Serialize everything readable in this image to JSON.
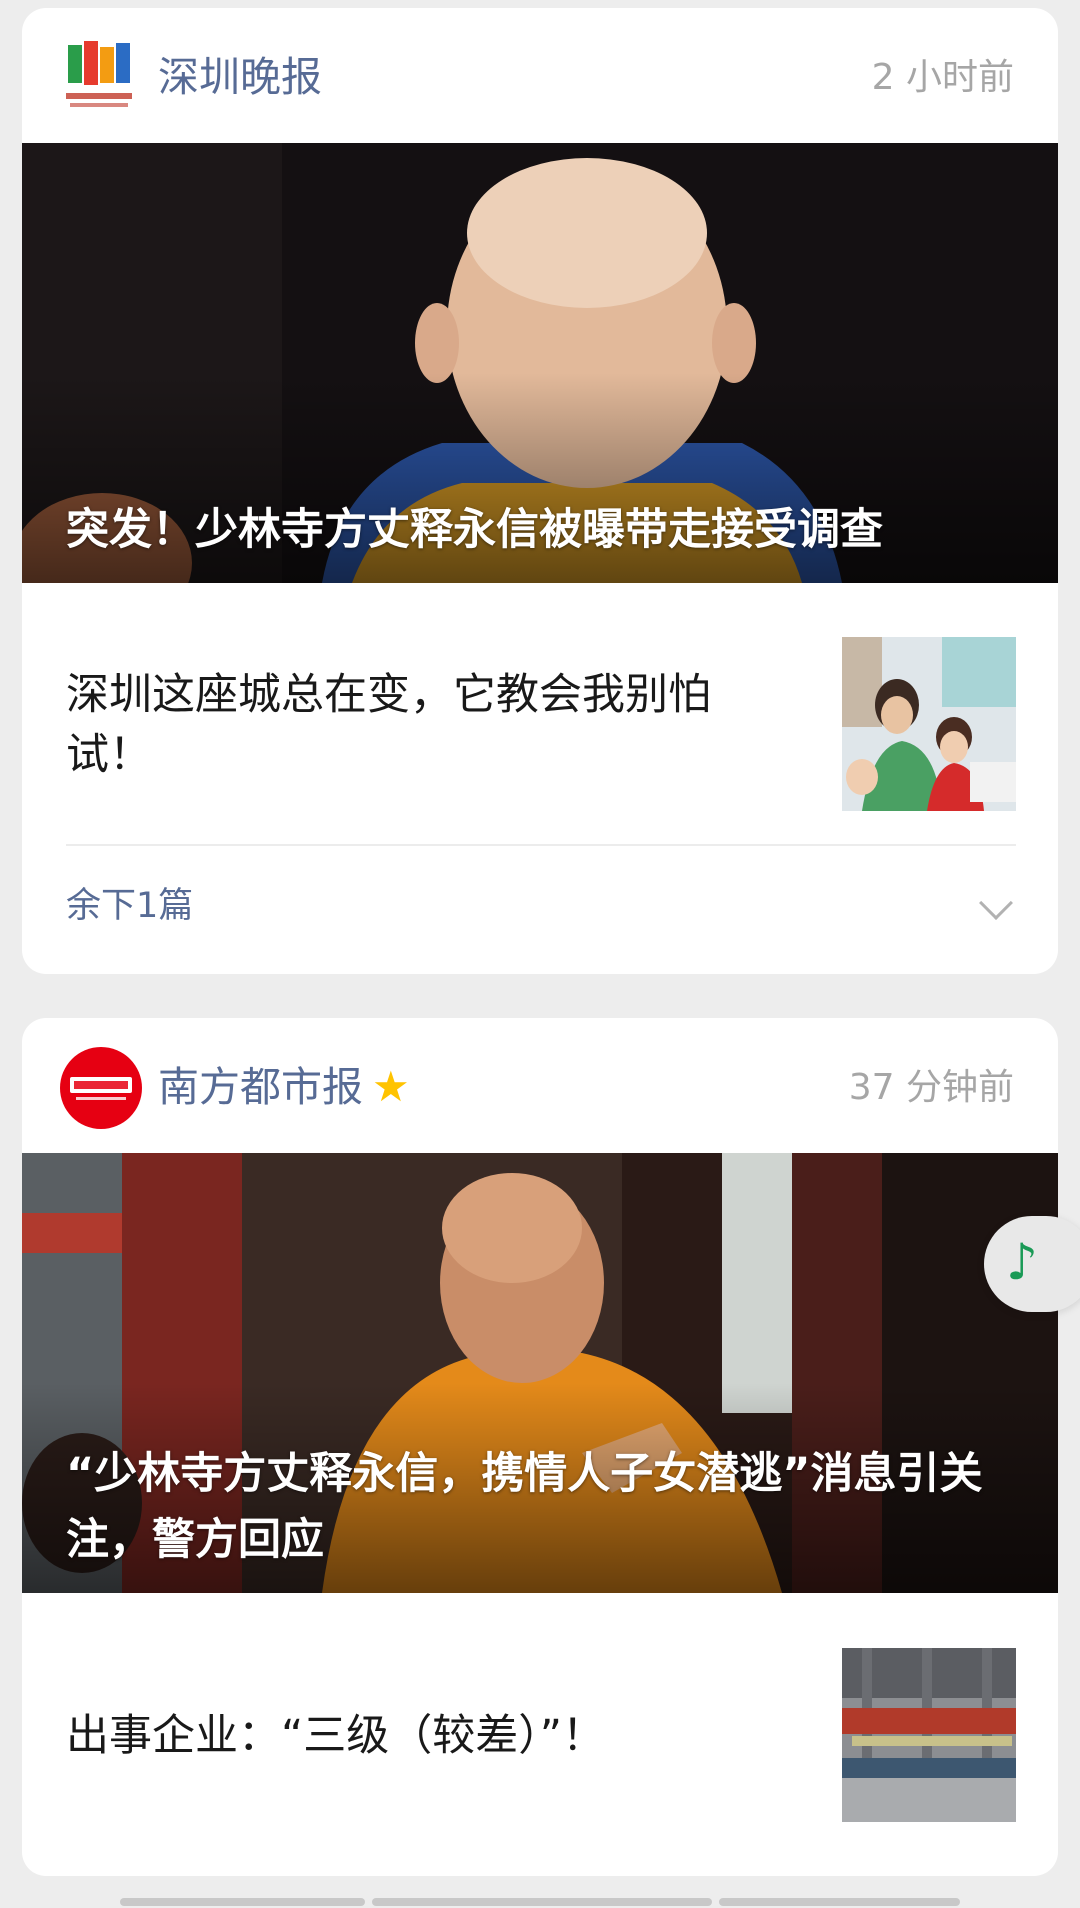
{
  "feed": {
    "cards": [
      {
        "source": {
          "name": "深圳晚报",
          "time": "2 小时前"
        },
        "hero": {
          "title": "突发！少林寺方丈释永信被曝带走接受调查"
        },
        "article": {
          "title": "深圳这座城总在变，它教会我别怕试！"
        },
        "more": {
          "label": "余下1篇"
        }
      },
      {
        "source": {
          "name": "南方都市报",
          "time": "37 分钟前",
          "starred": true
        },
        "hero": {
          "title": "“少林寺方丈释永信，携情人子女潜逃”消息引关注，警方回应"
        },
        "article": {
          "title": "出事企业：“三级（较差）”！"
        }
      }
    ]
  },
  "floating": {
    "icon": "music-note-icon"
  },
  "colors": {
    "link": "#576b95",
    "star": "#ffc300",
    "time": "#a6a6a6",
    "music": "#1a9a56",
    "southern_red": "#e60012"
  }
}
